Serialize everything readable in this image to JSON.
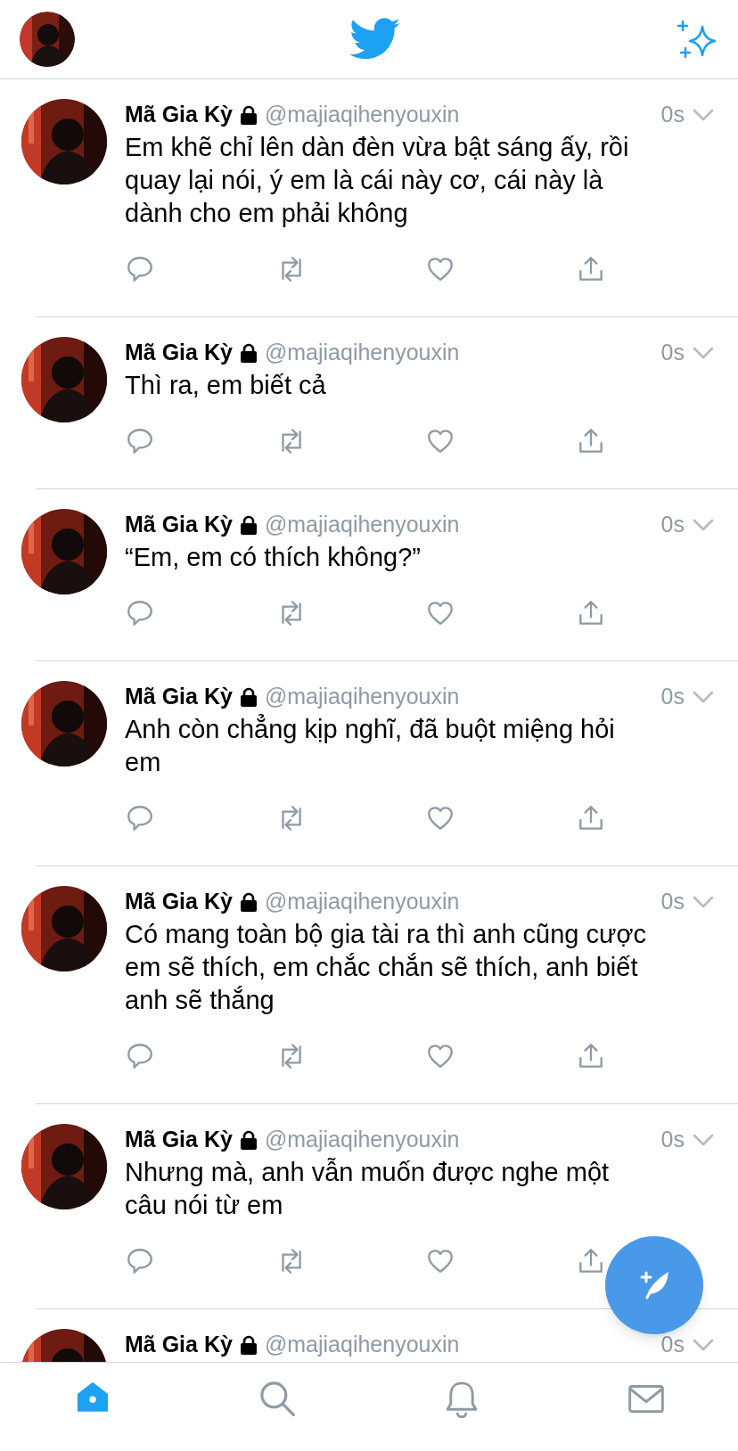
{
  "tweets": [
    {
      "kind": "full",
      "name": "Mã Gia Kỳ",
      "handle": "@majiaqihenyouxin",
      "time": "0s",
      "text": "Em khẽ chỉ lên dàn đèn vừa bật sáng ấy, rồi quay lại nói, ý em là cái này cơ, cái này là dành cho em phải không"
    },
    {
      "kind": "full",
      "name": "Mã Gia Kỳ",
      "handle": "@majiaqihenyouxin",
      "time": "0s",
      "text": "Thì ra, em biết cả"
    },
    {
      "kind": "full",
      "name": "Mã Gia Kỳ",
      "handle": "@majiaqihenyouxin",
      "time": "0s",
      "text": "“Em, em có thích không?”"
    },
    {
      "kind": "full",
      "name": "Mã Gia Kỳ",
      "handle": "@majiaqihenyouxin",
      "time": "0s",
      "text": "Anh còn chẳng kịp nghĩ, đã buột miệng hỏi em"
    },
    {
      "kind": "full",
      "name": "Mã Gia Kỳ",
      "handle": "@majiaqihenyouxin",
      "time": "0s",
      "text": "Có mang toàn bộ gia tài ra thì anh cũng cược em sẽ thích, em chắc chắn sẽ thích, anh biết anh sẽ thắng"
    },
    {
      "kind": "full",
      "name": "Mã Gia Kỳ",
      "handle": "@majiaqihenyouxin",
      "time": "0s",
      "text": "Nhưng mà, anh vẫn muốn được nghe một câu nói từ em"
    },
    {
      "kind": "cut",
      "name": "Mã Gia Kỳ",
      "handle": "@majiaqihenyouxin",
      "time": "0s"
    }
  ],
  "tab_bar": [
    {
      "kind": "home",
      "selected": true
    },
    {
      "kind": "search",
      "selected": false
    },
    {
      "kind": "notifications",
      "selected": false
    },
    {
      "kind": "messages",
      "selected": false
    }
  ]
}
